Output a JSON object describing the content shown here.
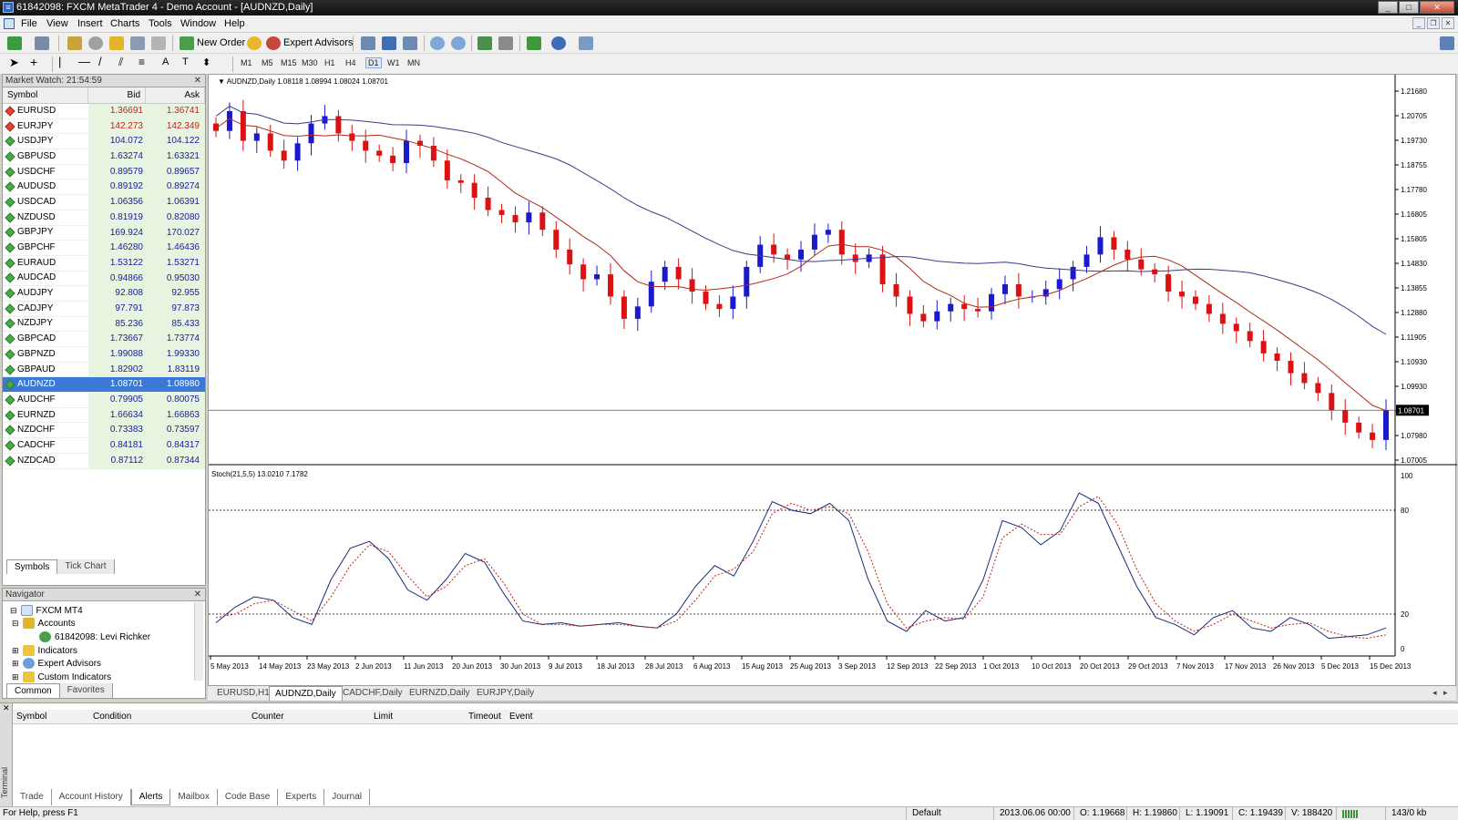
{
  "window": {
    "title": "61842098: FXCM MetaTrader 4 - Demo Account - [AUDNZD,Daily]"
  },
  "menu": [
    "File",
    "View",
    "Insert",
    "Charts",
    "Tools",
    "Window",
    "Help"
  ],
  "toolbar": {
    "new_order": "New Order",
    "expert_advisors": "Expert Advisors",
    "timeframes": [
      "M1",
      "M5",
      "M15",
      "M30",
      "H1",
      "H4",
      "D1",
      "W1",
      "MN"
    ],
    "active_timeframe": "D1"
  },
  "market_watch": {
    "title": "Market Watch: 21:54:59",
    "columns": [
      "Symbol",
      "Bid",
      "Ask"
    ],
    "rows": [
      {
        "symbol": "EURUSD",
        "bid": "1.36691",
        "ask": "1.36741",
        "dir": "down"
      },
      {
        "symbol": "EURJPY",
        "bid": "142.273",
        "ask": "142.349",
        "dir": "down"
      },
      {
        "symbol": "USDJPY",
        "bid": "104.072",
        "ask": "104.122",
        "dir": "up"
      },
      {
        "symbol": "GBPUSD",
        "bid": "1.63274",
        "ask": "1.63321",
        "dir": "up"
      },
      {
        "symbol": "USDCHF",
        "bid": "0.89579",
        "ask": "0.89657",
        "dir": "up"
      },
      {
        "symbol": "AUDUSD",
        "bid": "0.89192",
        "ask": "0.89274",
        "dir": "up"
      },
      {
        "symbol": "USDCAD",
        "bid": "1.06356",
        "ask": "1.06391",
        "dir": "up"
      },
      {
        "symbol": "NZDUSD",
        "bid": "0.81919",
        "ask": "0.82080",
        "dir": "up"
      },
      {
        "symbol": "GBPJPY",
        "bid": "169.924",
        "ask": "170.027",
        "dir": "up"
      },
      {
        "symbol": "GBPCHF",
        "bid": "1.46280",
        "ask": "1.46436",
        "dir": "up"
      },
      {
        "symbol": "EURAUD",
        "bid": "1.53122",
        "ask": "1.53271",
        "dir": "up"
      },
      {
        "symbol": "AUDCAD",
        "bid": "0.94866",
        "ask": "0.95030",
        "dir": "up"
      },
      {
        "symbol": "AUDJPY",
        "bid": "92.808",
        "ask": "92.955",
        "dir": "up"
      },
      {
        "symbol": "CADJPY",
        "bid": "97.791",
        "ask": "97.873",
        "dir": "up"
      },
      {
        "symbol": "NZDJPY",
        "bid": "85.236",
        "ask": "85.433",
        "dir": "up"
      },
      {
        "symbol": "GBPCAD",
        "bid": "1.73667",
        "ask": "1.73774",
        "dir": "up"
      },
      {
        "symbol": "GBPNZD",
        "bid": "1.99088",
        "ask": "1.99330",
        "dir": "up"
      },
      {
        "symbol": "GBPAUD",
        "bid": "1.82902",
        "ask": "1.83119",
        "dir": "up"
      },
      {
        "symbol": "AUDNZD",
        "bid": "1.08701",
        "ask": "1.08980",
        "dir": "up",
        "selected": true
      },
      {
        "symbol": "AUDCHF",
        "bid": "0.79905",
        "ask": "0.80075",
        "dir": "up"
      },
      {
        "symbol": "EURNZD",
        "bid": "1.66634",
        "ask": "1.66863",
        "dir": "up"
      },
      {
        "symbol": "NZDCHF",
        "bid": "0.73383",
        "ask": "0.73597",
        "dir": "up"
      },
      {
        "symbol": "CADCHF",
        "bid": "0.84181",
        "ask": "0.84317",
        "dir": "up"
      },
      {
        "symbol": "NZDCAD",
        "bid": "0.87112",
        "ask": "0.87344",
        "dir": "up"
      }
    ],
    "tabs": [
      "Symbols",
      "Tick Chart"
    ]
  },
  "navigator": {
    "title": "Navigator",
    "items": [
      "FXCM MT4",
      "Accounts",
      "61842098: Levi Richker",
      "Indicators",
      "Expert Advisors",
      "Custom Indicators"
    ],
    "tabs": [
      "Common",
      "Favorites"
    ]
  },
  "chart": {
    "label": "AUDNZD,Daily  1.08118 1.08994 1.08024 1.08701",
    "stoch_label": "Stoch(21,5,5) 13.0210 7.1782",
    "price_ticks": [
      "1.21680",
      "1.20705",
      "1.19730",
      "1.18755",
      "1.17780",
      "1.16805",
      "1.15805",
      "1.14830",
      "1.13855",
      "1.12880",
      "1.11905",
      "1.10930",
      "1.09930",
      "1.08955",
      "1.07980",
      "1.07005"
    ],
    "current_price": "1.08701",
    "stoch_ticks": [
      "100",
      "80",
      "20",
      "0"
    ],
    "date_ticks": [
      "5 May 2013",
      "14 May 2013",
      "23 May 2013",
      "2 Jun 2013",
      "11 Jun 2013",
      "20 Jun 2013",
      "30 Jun 2013",
      "9 Jul 2013",
      "18 Jul 2013",
      "28 Jul 2013",
      "6 Aug 2013",
      "15 Aug 2013",
      "25 Aug 2013",
      "3 Sep 2013",
      "12 Sep 2013",
      "22 Sep 2013",
      "1 Oct 2013",
      "10 Oct 2013",
      "20 Oct 2013",
      "29 Oct 2013",
      "7 Nov 2013",
      "17 Nov 2013",
      "26 Nov 2013",
      "5 Dec 2013",
      "15 Dec 2013"
    ],
    "tabs": [
      "EURUSD,H1",
      "AUDNZD,Daily",
      "CADCHF,Daily",
      "EURNZD,Daily",
      "EURJPY,Daily"
    ],
    "active_tab": "AUDNZD,Daily",
    "colors": {
      "bull": "#1a1acc",
      "bear": "#dd1111",
      "ma_fast": "#b02a1a",
      "ma_slow": "#3a3a8c"
    }
  },
  "chart_data": {
    "type": "candlestick",
    "symbol": "AUDNZD,Daily",
    "ohlc_last": {
      "open": 1.08118,
      "high": 1.08994,
      "low": 1.08024,
      "close": 1.08701
    },
    "close_path": [
      1.2,
      1.208,
      1.196,
      1.199,
      1.192,
      1.188,
      1.195,
      1.203,
      1.206,
      1.199,
      1.196,
      1.192,
      1.19,
      1.187,
      1.196,
      1.194,
      1.188,
      1.18,
      1.179,
      1.173,
      1.168,
      1.166,
      1.163,
      1.167,
      1.16,
      1.152,
      1.146,
      1.14,
      1.142,
      1.133,
      1.124,
      1.129,
      1.139,
      1.145,
      1.14,
      1.135,
      1.13,
      1.128,
      1.133,
      1.145,
      1.154,
      1.15,
      1.148,
      1.152,
      1.158,
      1.16,
      1.15,
      1.147,
      1.15,
      1.138,
      1.133,
      1.126,
      1.123,
      1.127,
      1.13,
      1.128,
      1.127,
      1.134,
      1.138,
      1.133,
      1.133,
      1.136,
      1.14,
      1.145,
      1.15,
      1.157,
      1.152,
      1.148,
      1.144,
      1.142,
      1.135,
      1.133,
      1.13,
      1.126,
      1.122,
      1.119,
      1.115,
      1.11,
      1.107,
      1.102,
      1.098,
      1.094,
      1.087,
      1.082,
      1.078,
      1.075,
      1.087
    ],
    "ylim": [
      1.065,
      1.222
    ],
    "stoch_main": [
      15,
      24,
      30,
      28,
      18,
      14,
      40,
      58,
      62,
      52,
      34,
      28,
      40,
      55,
      50,
      32,
      16,
      14,
      15,
      13,
      14,
      15,
      13,
      12,
      20,
      36,
      48,
      42,
      62,
      85,
      80,
      78,
      84,
      74,
      40,
      16,
      10,
      22,
      16,
      18,
      40,
      74,
      70,
      60,
      68,
      90,
      84,
      60,
      36,
      18,
      14,
      8,
      18,
      22,
      12,
      10,
      18,
      14,
      6,
      7,
      8,
      12
    ],
    "stoch_signal": [
      18,
      20,
      26,
      28,
      22,
      16,
      30,
      48,
      60,
      56,
      42,
      30,
      36,
      48,
      52,
      38,
      20,
      14,
      14,
      13,
      14,
      14,
      13,
      12,
      16,
      28,
      42,
      46,
      56,
      78,
      84,
      80,
      82,
      78,
      56,
      26,
      12,
      16,
      18,
      17,
      30,
      64,
      72,
      66,
      66,
      82,
      88,
      72,
      46,
      26,
      16,
      10,
      14,
      20,
      16,
      12,
      14,
      15,
      10,
      7,
      6,
      8
    ],
    "stoch_levels": [
      80,
      20
    ]
  },
  "terminal": {
    "label": "Terminal",
    "columns": [
      "Symbol",
      "Condition",
      "Counter",
      "Limit",
      "Timeout",
      "Event"
    ],
    "tabs": [
      "Trade",
      "Account History",
      "Alerts",
      "Mailbox",
      "Code Base",
      "Experts",
      "Journal"
    ],
    "active_tab": "Alerts"
  },
  "statusbar": {
    "help": "For Help, press F1",
    "profile": "Default",
    "datetime": "2013.06.06 00:00",
    "open": "O: 1.19668",
    "high": "H: 1.19860",
    "low": "L: 1.19091",
    "close": "C: 1.19439",
    "volume": "V: 188420",
    "traffic": "143/0 kb"
  }
}
